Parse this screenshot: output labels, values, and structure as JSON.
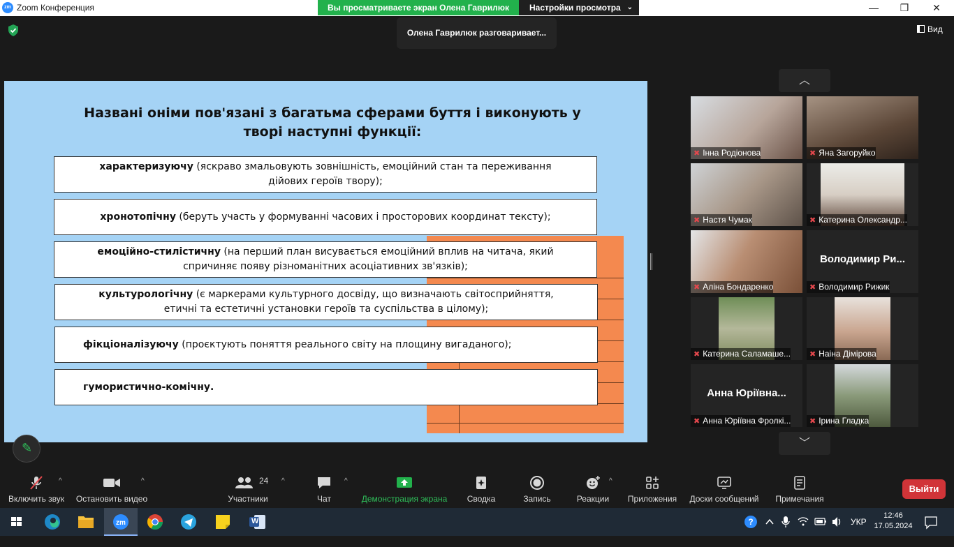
{
  "window": {
    "app_name": "Zoom Конференция",
    "app_icon_text": "zm",
    "minimize": "—",
    "restore": "❐",
    "close": "✕"
  },
  "share_banner": {
    "text": "Вы просматриваете экран Олена Гаврилюк",
    "view_settings": "Настройки просмотра"
  },
  "speaking_indicator": "Олена Гаврилюк разговаривает...",
  "view_button": "Вид",
  "slide": {
    "title": "Названі оніми пов'язані з багатьма сферами буття і виконують у творі наступні функції:",
    "items": [
      {
        "term": "характеризуючу",
        "desc": " (яскраво змальовують зовнішність, емоційний стан та переживання дійових героїв твору);"
      },
      {
        "term": "хронотопічну",
        "desc": " (беруть участь у формуванні часових і просторових координат тексту);"
      },
      {
        "term": "емоційно-стилістичну",
        "desc": " (на перший план висувається емоційний вплив на читача, який спричиняє появу різноманітних асоціативних зв'язків);"
      },
      {
        "term": "культурологічну",
        "desc": " (є маркерами культурного досвіду, що визначають світосприйняття, етичні та естетичні установки героїв та суспільства в цілому);"
      },
      {
        "term": "фікціоналізуючу",
        "desc": " (проєктують поняття реального світу на площину вигаданого);"
      },
      {
        "term": "гумористично-комічну.",
        "desc": ""
      }
    ]
  },
  "gallery": {
    "up": "︿",
    "down": "﹀",
    "participants": [
      {
        "name": "Інна Родіонова",
        "big": ""
      },
      {
        "name": "Яна Загоруйко",
        "big": ""
      },
      {
        "name": "Настя Чумак",
        "big": ""
      },
      {
        "name": "Катерина Олександр...",
        "big": ""
      },
      {
        "name": "Аліна Бондаренко",
        "big": ""
      },
      {
        "name": "Володимир Рижик",
        "big": "Володимир Ри..."
      },
      {
        "name": "Катерина Саламаше...",
        "big": ""
      },
      {
        "name": "Наіна Дімірова",
        "big": ""
      },
      {
        "name": "Анна Юріївна Фролкі...",
        "big": "Анна Юріївна..."
      },
      {
        "name": "Ірина Гладка",
        "big": ""
      }
    ]
  },
  "toolbar": {
    "mute": "Включить звук",
    "video": "Остановить видео",
    "participants": "Участники",
    "participants_count": "24",
    "chat": "Чат",
    "share": "Демонстрация экрана",
    "summary": "Сводка",
    "record": "Запись",
    "reactions": "Реакции",
    "apps": "Приложения",
    "whiteboards": "Доски сообщений",
    "notes": "Примечания",
    "leave": "Выйти"
  },
  "taskbar": {
    "language": "УКР",
    "time": "12:46",
    "date": "17.05.2024",
    "word_label": "W"
  },
  "colors": {
    "slide_bg": "#a5d3f5",
    "orange": "#f4894f",
    "share_green": "#22b14c",
    "leave_red": "#d13438"
  }
}
